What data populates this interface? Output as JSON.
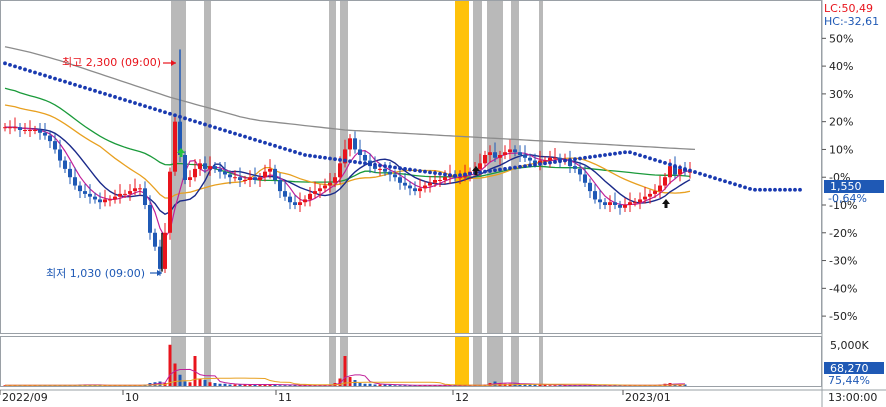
{
  "chart_data": {
    "type": "candlestick",
    "top_right": {
      "lc": "LC:50,49",
      "hc": "HC:-32,61"
    },
    "price_axis": {
      "ticks": [
        "50%",
        "40%",
        "30%",
        "20%",
        "10%",
        "-0%",
        "-10%",
        "-20%",
        "-30%",
        "-40%",
        "-50%"
      ],
      "tick_values": [
        50,
        40,
        30,
        20,
        10,
        0,
        -10,
        -20,
        -30,
        -40,
        -50
      ],
      "ylim": [
        -55,
        62
      ],
      "current_price": "1,550",
      "current_change": "-0,64%",
      "current_change_value": -0.64
    },
    "volume_axis": {
      "max_label": "5,000K",
      "current_volume": "68,270",
      "current_ratio": "75,44%"
    },
    "x_axis": {
      "labels": [
        "2022/09",
        "10",
        "11",
        "12",
        "2023/01"
      ],
      "time_label": "13:00:00"
    },
    "annotations": {
      "high": {
        "label": "최고 2,300 (09:00)",
        "value_pct": 46
      },
      "low": {
        "label": "최저 1,030 (09:00)",
        "value_pct": -34
      }
    },
    "colors": {
      "up": "#e8141c",
      "down": "#1f59b5",
      "highlight_gray": "#b9b9b9",
      "highlight_gold": "#ffc20a",
      "ma_gray": "#8c8c8c",
      "ma_green": "#1a9a3a",
      "ma_orange": "#e8a020",
      "ma_navy": "#1a2a8a",
      "ma_magenta": "#c0209a",
      "dot_blue": "#1a3ab0",
      "price_tag_bg": "#1f59b5"
    },
    "closes": [
      18,
      18,
      18,
      17,
      17,
      17,
      17,
      16,
      15,
      13,
      10,
      6,
      3,
      0,
      -3,
      -5,
      -6,
      -7,
      -8,
      -9,
      -8,
      -8,
      -7,
      -6,
      -6,
      -5,
      -4,
      -4,
      -10,
      -20,
      -25,
      -33,
      -20,
      2,
      20,
      8,
      -1,
      0,
      3,
      5,
      3,
      4,
      3,
      2,
      1,
      0,
      0,
      -1,
      -1,
      0,
      -1,
      0,
      2,
      3,
      -1,
      -5,
      -7,
      -9,
      -10,
      -9,
      -8,
      -6,
      -5,
      -4,
      -3,
      -2,
      0,
      5,
      10,
      14,
      10,
      8,
      6,
      4,
      3,
      3,
      2,
      1,
      0,
      -2,
      -3,
      -4,
      -5,
      -4,
      -3,
      -2,
      -1,
      -1,
      0,
      1,
      0,
      0,
      1,
      2,
      3,
      5,
      8,
      9,
      7,
      8,
      9,
      10,
      9,
      8,
      7,
      6,
      5,
      6,
      6,
      7,
      7,
      6,
      6,
      4,
      3,
      1,
      -2,
      -5,
      -8,
      -9,
      -10,
      -9,
      -10,
      -11,
      -10,
      -9,
      -9,
      -8,
      -7,
      -6,
      -5,
      -3,
      0,
      4,
      1,
      3,
      2,
      2
    ],
    "volumes": [
      1,
      1,
      1,
      1,
      1,
      1,
      1,
      1,
      1,
      1,
      1,
      1,
      1,
      1,
      1,
      2,
      2,
      1,
      1,
      1,
      1,
      1,
      1,
      1,
      1,
      1,
      1,
      1,
      2,
      4,
      5,
      6,
      4,
      55,
      30,
      15,
      6,
      5,
      40,
      10,
      8,
      5,
      4,
      3,
      3,
      2,
      2,
      2,
      2,
      2,
      2,
      2,
      2,
      2,
      2,
      1,
      1,
      1,
      2,
      1,
      1,
      1,
      1,
      1,
      1,
      2,
      4,
      10,
      40,
      12,
      8,
      4,
      3,
      3,
      2,
      2,
      2,
      2,
      1,
      1,
      1,
      1,
      1,
      1,
      1,
      1,
      1,
      1,
      1,
      1,
      1,
      1,
      1,
      1,
      1,
      1,
      2,
      4,
      6,
      4,
      3,
      3,
      3,
      3,
      3,
      2,
      2,
      2,
      2,
      1,
      1,
      1,
      1,
      1,
      1,
      1,
      1,
      1,
      1,
      1,
      1,
      1,
      1,
      1,
      1,
      1,
      1,
      1,
      1,
      1,
      1,
      2,
      3,
      4,
      3,
      2,
      2
    ],
    "ma_long_gray": [
      47,
      46.6,
      46.2,
      45.8,
      45.4,
      45,
      44.5,
      44,
      43.5,
      43,
      42.5,
      42,
      41.4,
      40.8,
      40.2,
      39.6,
      39,
      38.4,
      37.8,
      37.2,
      36.6,
      36,
      35.4,
      34.8,
      34.2,
      33.6,
      33,
      32.4,
      31.8,
      31.2,
      30.6,
      30,
      29.4,
      28.8,
      28.3,
      27.8,
      27.3,
      26.8,
      26.3,
      25.8,
      25.3,
      24.8,
      24.3,
      23.8,
      23.3,
      22.8,
      22.3,
      21.8,
      21.4,
      21,
      20.7,
      20.4,
      20.2,
      20,
      19.8,
      19.6,
      19.4,
      19.2,
      19,
      18.8,
      18.6,
      18.4,
      18.2,
      18,
      17.8,
      17.6,
      17.4,
      17.2,
      17,
      16.9,
      16.8,
      16.7,
      16.6,
      16.5,
      16.4,
      16.3,
      16.2,
      16.1,
      16,
      15.9,
      15.8,
      15.7,
      15.6,
      15.5,
      15.4,
      15.3,
      15.2,
      15.1,
      15,
      14.9,
      14.8,
      14.7,
      14.6,
      14.5,
      14.4,
      14.3,
      14.2,
      14.1,
      14,
      13.9,
      13.8,
      13.7,
      13.6,
      13.5,
      13.4,
      13.3,
      13.2,
      13.1,
      13,
      12.9,
      12.8,
      12.7,
      12.6,
      12.5,
      12.4,
      12.3,
      12.2,
      12.1,
      12,
      11.9,
      11.8,
      11.7,
      11.6,
      11.5,
      11.4,
      11.3,
      11.2,
      11.1,
      11,
      10.9,
      10.8,
      10.7,
      10.6,
      10.5,
      10.4,
      10.3,
      10.2,
      10.1,
      10
    ]
  }
}
